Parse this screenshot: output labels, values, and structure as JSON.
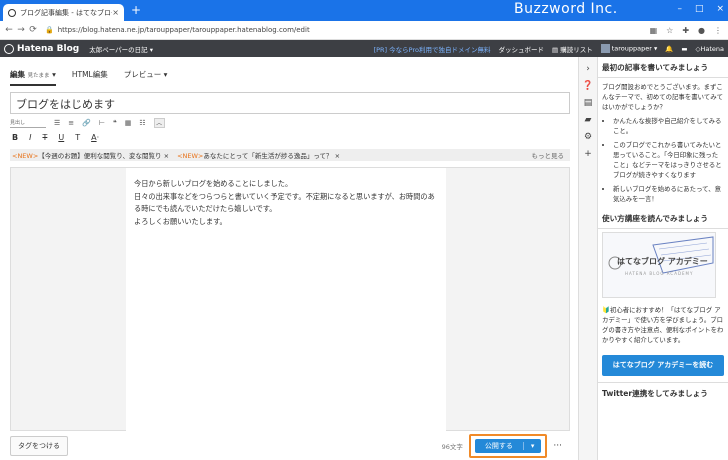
{
  "browser": {
    "tab_title": "ブログ記事編集 - はてなブログ",
    "close": "×",
    "new_tab": "+",
    "watermark": "Buzzword Inc.",
    "url": "https://blog.hatena.ne.jp/tarouppaper/tarouppaper.hatenablog.com/edit",
    "win_min": "–",
    "win_max": "□",
    "win_close": "×"
  },
  "hatena_bar": {
    "logo": "Hatena Blog",
    "blog_name": "太郎ペーパーの日記 ▾",
    "pro_link": "[PR] 今ならPro利用で独自ドメイン無料",
    "dashboard": "ダッシュボード",
    "reading_list": "購読リスト",
    "user": "tarouppaper ▾",
    "hatena": "Hatena"
  },
  "editor": {
    "tab_edit": "編集",
    "tab_edit_mode": "見たまま",
    "tab_html": "HTML編集",
    "tab_preview": "プレビュー",
    "title": "ブログをはじめます",
    "format_select": "見出し",
    "news": [
      {
        "tag": "<NEW>",
        "text": "【今週のお題】便利な閲覧り、変な閲覧り ×"
      },
      {
        "tag": "<NEW>",
        "text": "あなたにとって「新生活が捗る逸品」って？ ×"
      }
    ],
    "news_more": "もっと見る",
    "body": [
      "今日から新しいブログを始めることにしました。",
      "日々の出来事などをつらつらと書いていく予定です。不定期になると思いますが、お時間のある時にでも読んでいただけたら嬉しいです。",
      "よろしくお願いいたします。"
    ],
    "tag_button": "タグをつける",
    "char_count": "96文字",
    "publish": "公開する",
    "publish_dd": "▾",
    "more": "···"
  },
  "sidebar": {
    "heading1": "最初の記事を書いてみましょう",
    "intro": "ブログ開設おめでとうございます。まずこんなテーマで、初めての記事を書いてみてはいかがでしょうか？",
    "suggestions": [
      "かんたんな挨拶や自己紹介をしてみること。",
      "このブログでこれから書いてみたいと思っていること。「今日印象に残ったこと」などテーマをはっきりさせるとブログが続きやすくなります",
      "新しいブログを始めるにあたって、意気込みを一言！"
    ],
    "heading2": "使い方講座を読んでみましょう",
    "academy_title": "はてなブログ アカデミー",
    "academy_sub": "HATENA BLOG ACADEMY",
    "academy_text": "初心者におすすめ！「はてなブログ アカデミー」で使い方を学びましょう。ブログの書き方や注意点、便利なポイントをわかりやすく紹介しています。",
    "academy_button": "はてなブログ アカデミーを読む",
    "heading3": "Twitter連携をしてみましょう"
  },
  "colors": {
    "chrome": "#1a73e8",
    "hatena_bar": "#3d3f44",
    "accent": "#2489d8",
    "highlight": "#f08a28"
  }
}
